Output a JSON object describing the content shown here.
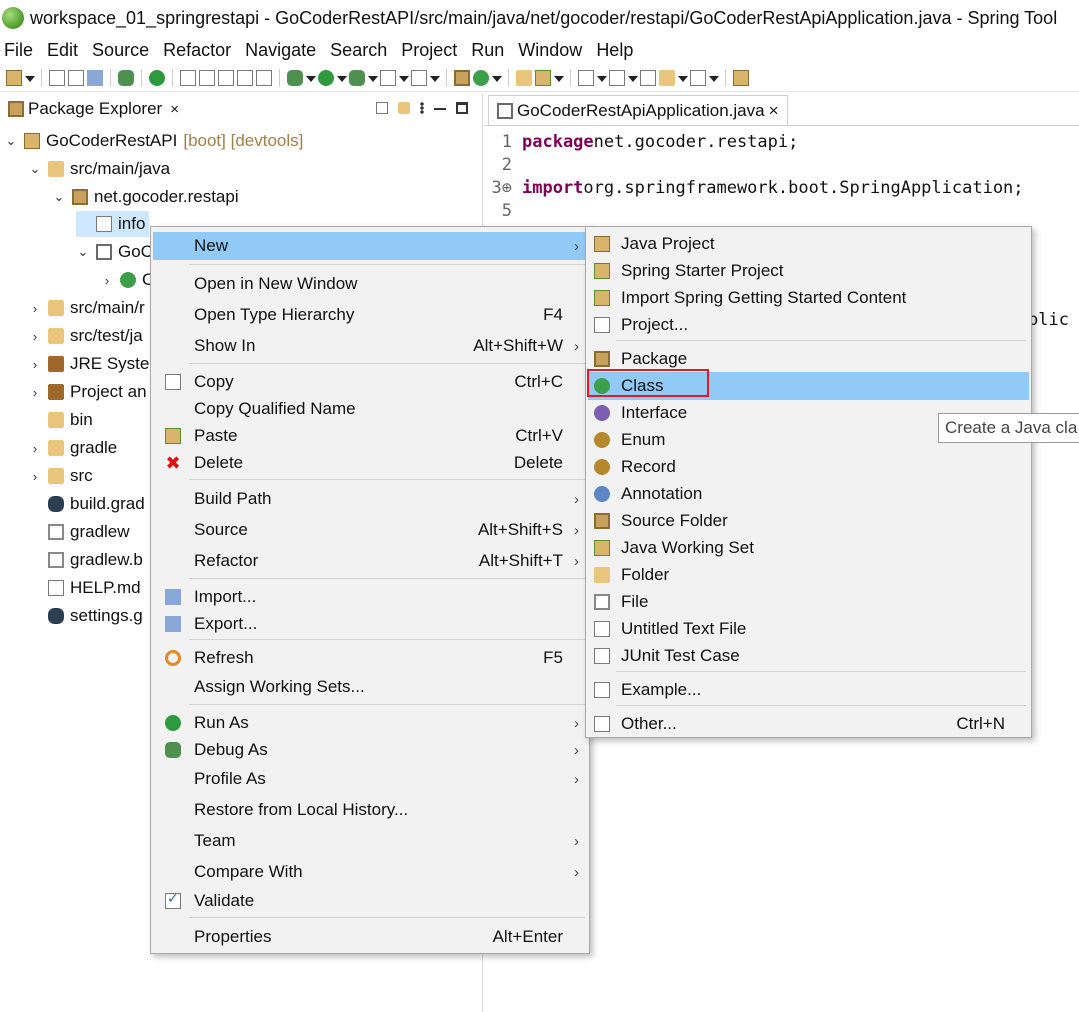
{
  "window": {
    "title": "workspace_01_springrestapi - GoCoderRestAPI/src/main/java/net/gocoder/restapi/GoCoderRestApiApplication.java - Spring Tool"
  },
  "menubar": [
    {
      "label": "File"
    },
    {
      "label": "Edit"
    },
    {
      "label": "Source"
    },
    {
      "label": "Refactor"
    },
    {
      "label": "Navigate"
    },
    {
      "label": "Search"
    },
    {
      "label": "Project"
    },
    {
      "label": "Run"
    },
    {
      "label": "Window"
    },
    {
      "label": "Help"
    }
  ],
  "explorer": {
    "tab_label": "Package Explorer",
    "close_glyph": "×",
    "tree": [
      {
        "label": "GoCoderRestAPI",
        "decoration": "[boot] [devtools]",
        "twisty": "⌄",
        "icon": "project-icon"
      },
      {
        "label": "src/main/java",
        "twisty": "⌄",
        "icon": "source-folder-icon"
      },
      {
        "label": "net.gocoder.restapi",
        "twisty": "⌄",
        "icon": "package-icon"
      },
      {
        "label": "info",
        "twisty": "",
        "icon": "empty-package-icon",
        "selected": true
      },
      {
        "label": "GoC",
        "twisty": "⌄",
        "icon": "java-file-icon"
      },
      {
        "label": "C",
        "twisty": "›",
        "icon": "class-icon"
      },
      {
        "label": "src/main/r",
        "twisty": "›",
        "icon": "source-folder-icon"
      },
      {
        "label": "src/test/ja",
        "twisty": "›",
        "icon": "source-folder-icon"
      },
      {
        "label": "JRE Syster",
        "twisty": "›",
        "icon": "library-icon"
      },
      {
        "label": "Project an",
        "twisty": "›",
        "icon": "library-icon"
      },
      {
        "label": "bin",
        "twisty": "",
        "icon": "folder-icon"
      },
      {
        "label": "gradle",
        "twisty": "›",
        "icon": "folder-icon"
      },
      {
        "label": "src",
        "twisty": "›",
        "icon": "folder-icon"
      },
      {
        "label": "build.grad",
        "twisty": "",
        "icon": "gradle-icon"
      },
      {
        "label": "gradlew",
        "twisty": "",
        "icon": "file-icon"
      },
      {
        "label": "gradlew.b",
        "twisty": "",
        "icon": "file-icon"
      },
      {
        "label": "HELP.md",
        "twisty": "",
        "icon": "markdown-file-icon"
      },
      {
        "label": "settings.g",
        "twisty": "",
        "icon": "gradle-icon"
      }
    ]
  },
  "editor": {
    "tab_label": "GoCoderRestApiApplication.java",
    "close_glyph": "×",
    "lines": [
      {
        "num": "1",
        "kw": "package",
        "text": " net.gocoder.restapi;"
      },
      {
        "num": "2",
        "kw": "",
        "text": ""
      },
      {
        "num": "3⊕",
        "kw": "import",
        "text": " org.springframework.boot.SpringApplication;"
      },
      {
        "num": "5",
        "kw": "",
        "text": ""
      }
    ],
    "partial_text": "plic"
  },
  "context_menu": {
    "items": [
      {
        "label": "New",
        "accel": "",
        "submenu": true,
        "icon": "",
        "highlighted": true
      },
      {
        "label": "Open in New Window",
        "accel": "",
        "submenu": false,
        "icon": ""
      },
      {
        "label": "Open Type Hierarchy",
        "accel": "F4",
        "submenu": false,
        "icon": ""
      },
      {
        "label": "Show In",
        "accel": "Alt+Shift+W",
        "submenu": true,
        "icon": ""
      },
      {
        "label": "Copy",
        "accel": "Ctrl+C",
        "submenu": false,
        "icon": "copy-icon"
      },
      {
        "label": "Copy Qualified Name",
        "accel": "",
        "submenu": false,
        "icon": ""
      },
      {
        "label": "Paste",
        "accel": "Ctrl+V",
        "submenu": false,
        "icon": "paste-icon"
      },
      {
        "label": "Delete",
        "accel": "Delete",
        "submenu": false,
        "icon": "delete-icon"
      },
      {
        "label": "Build Path",
        "accel": "",
        "submenu": true,
        "icon": ""
      },
      {
        "label": "Source",
        "accel": "Alt+Shift+S",
        "submenu": true,
        "icon": ""
      },
      {
        "label": "Refactor",
        "accel": "Alt+Shift+T",
        "submenu": true,
        "icon": ""
      },
      {
        "label": "Import...",
        "accel": "",
        "submenu": false,
        "icon": "import-icon"
      },
      {
        "label": "Export...",
        "accel": "",
        "submenu": false,
        "icon": "export-icon"
      },
      {
        "label": "Refresh",
        "accel": "F5",
        "submenu": false,
        "icon": "refresh-icon"
      },
      {
        "label": "Assign Working Sets...",
        "accel": "",
        "submenu": false,
        "icon": ""
      },
      {
        "label": "Run As",
        "accel": "",
        "submenu": true,
        "icon": "run-icon"
      },
      {
        "label": "Debug As",
        "accel": "",
        "submenu": true,
        "icon": "debug-icon"
      },
      {
        "label": "Profile As",
        "accel": "",
        "submenu": true,
        "icon": ""
      },
      {
        "label": "Restore from Local History...",
        "accel": "",
        "submenu": false,
        "icon": ""
      },
      {
        "label": "Team",
        "accel": "",
        "submenu": true,
        "icon": ""
      },
      {
        "label": "Compare With",
        "accel": "",
        "submenu": true,
        "icon": ""
      },
      {
        "label": "Validate",
        "accel": "",
        "submenu": false,
        "icon": "checkbox-icon"
      },
      {
        "label": "Properties",
        "accel": "Alt+Enter",
        "submenu": false,
        "icon": ""
      }
    ]
  },
  "new_submenu": {
    "items": [
      {
        "label": "Java Project",
        "accel": "",
        "icon": "java-project-icon"
      },
      {
        "label": "Spring Starter Project",
        "accel": "",
        "icon": "spring-project-icon"
      },
      {
        "label": "Import Spring Getting Started Content",
        "accel": "",
        "icon": "spring-import-icon"
      },
      {
        "label": "Project...",
        "accel": "",
        "icon": "project-wizard-icon"
      },
      {
        "label": "Package",
        "accel": "",
        "icon": "package-icon"
      },
      {
        "label": "Class",
        "accel": "",
        "icon": "class-icon",
        "highlighted": true
      },
      {
        "label": "Interface",
        "accel": "",
        "icon": "interface-icon"
      },
      {
        "label": "Enum",
        "accel": "",
        "icon": "enum-icon"
      },
      {
        "label": "Record",
        "accel": "",
        "icon": "record-icon"
      },
      {
        "label": "Annotation",
        "accel": "",
        "icon": "annotation-icon"
      },
      {
        "label": "Source Folder",
        "accel": "",
        "icon": "source-folder-icon"
      },
      {
        "label": "Java Working Set",
        "accel": "",
        "icon": "working-set-icon"
      },
      {
        "label": "Folder",
        "accel": "",
        "icon": "folder-icon"
      },
      {
        "label": "File",
        "accel": "",
        "icon": "file-icon"
      },
      {
        "label": "Untitled Text File",
        "accel": "",
        "icon": "text-file-icon"
      },
      {
        "label": "JUnit Test Case",
        "accel": "",
        "icon": "junit-icon"
      },
      {
        "label": "Example...",
        "accel": "",
        "icon": "example-icon"
      },
      {
        "label": "Other...",
        "accel": "Ctrl+N",
        "icon": "other-wizard-icon"
      }
    ]
  },
  "tooltip": {
    "text": "Create a Java cla"
  },
  "colors": {
    "menu_highlight": "#91c9f7",
    "annotation_box": "#e01b24",
    "keyword": "#7f0055",
    "selection": "#cde8ff"
  }
}
